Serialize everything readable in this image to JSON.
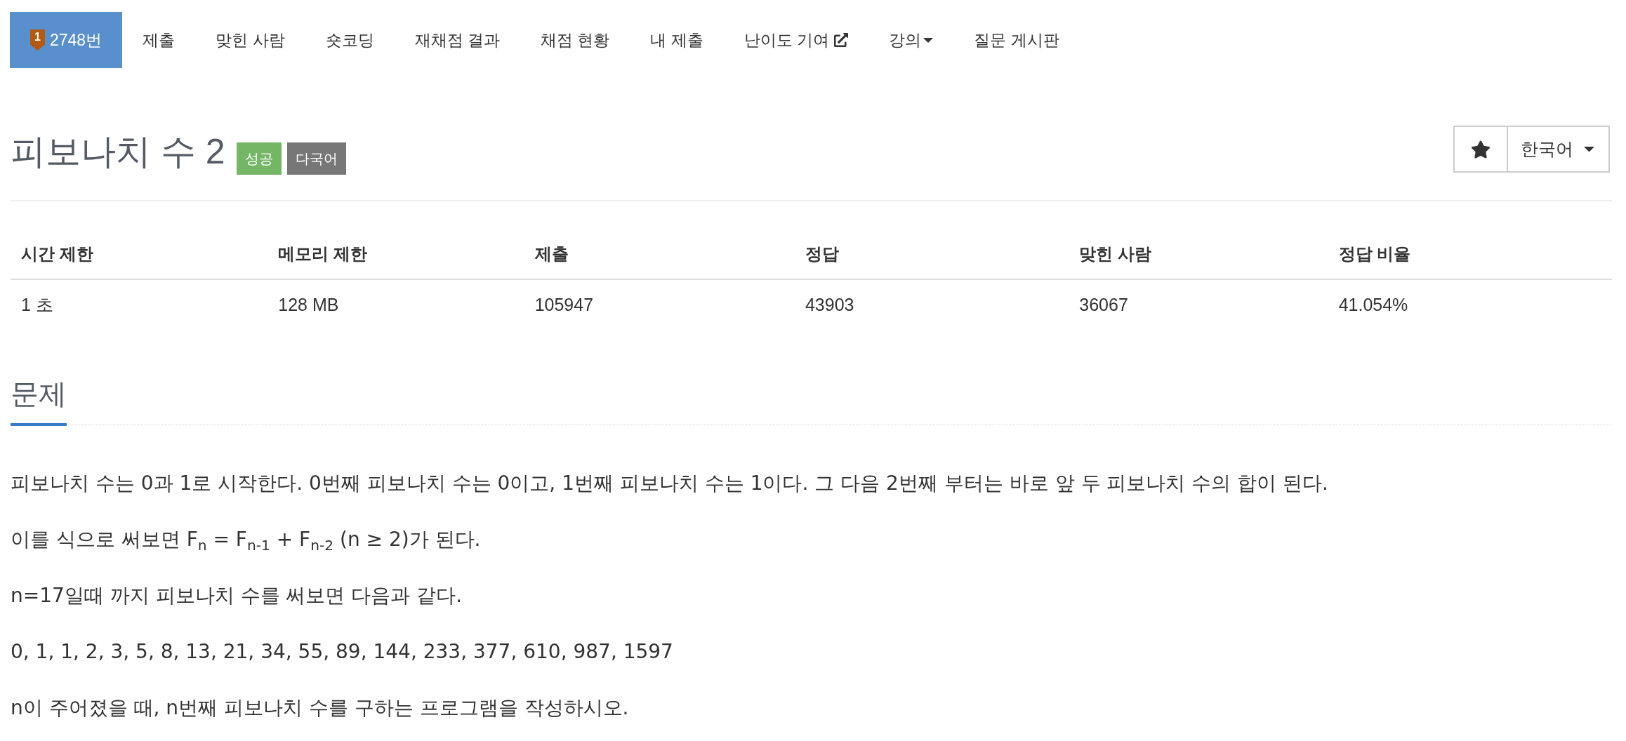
{
  "nav_tabs": [
    {
      "kind": "problem",
      "tier": "1",
      "label": "2748번",
      "selected": true
    },
    {
      "kind": "link",
      "label": "제출",
      "selected": false
    },
    {
      "kind": "link",
      "label": "맞힌 사람",
      "selected": false
    },
    {
      "kind": "link",
      "label": "숏코딩",
      "selected": false
    },
    {
      "kind": "link",
      "label": "재채점 결과",
      "selected": false
    },
    {
      "kind": "link",
      "label": "채점 현황",
      "selected": false
    },
    {
      "kind": "link",
      "label": "내 제출",
      "selected": false
    },
    {
      "kind": "external",
      "label": "난이도 기여",
      "selected": false
    },
    {
      "kind": "dropdown",
      "label": "강의",
      "selected": false
    },
    {
      "kind": "link",
      "label": "질문 게시판",
      "selected": false
    }
  ],
  "problem": {
    "title": "피보나치 수 2",
    "labels": [
      {
        "text": "성공",
        "color": "#74b566"
      },
      {
        "text": "다국어",
        "color": "#777777"
      }
    ]
  },
  "language_select": {
    "value": "한국어"
  },
  "stats_table": {
    "columns": [
      "시간 제한",
      "메모리 제한",
      "제출",
      "정답",
      "맞힌 사람",
      "정답 비율"
    ],
    "rows": [
      [
        "1 초",
        "128 MB",
        "105947",
        "43903",
        "36067",
        "41.054%"
      ]
    ]
  },
  "description": {
    "heading": "문제",
    "paragraphs": [
      "피보나치 수는 0과 1로 시작한다. 0번째 피보나치 수는 0이고, 1번째 피보나치 수는 1이다. 그 다음 2번째 부터는 바로 앞 두 피보나치 수의 합이 된다.",
      "이를 식으로 써보면 F$_{n}$ = F$_{n-1}$ + F$_{n-2}$ (n ≥ 2)가 된다.",
      "n=17일때 까지 피보나치 수를 써보면 다음과 같다.",
      "0, 1, 1, 2, 3, 5, 8, 13, 21, 34, 55, 89, 144, 233, 377, 610, 987, 1597",
      "n이 주어졌을 때, n번째 피보나치 수를 구하는 프로그램을 작성하시오."
    ]
  }
}
